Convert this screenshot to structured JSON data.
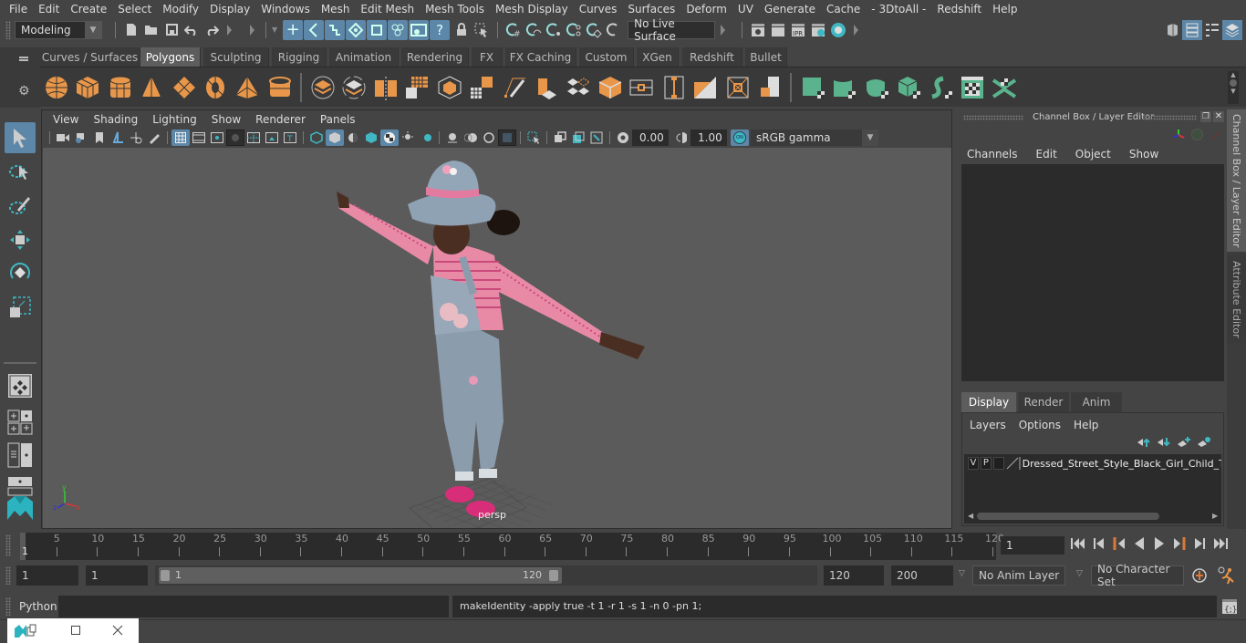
{
  "menubar": {
    "items": [
      "File",
      "Edit",
      "Create",
      "Select",
      "Modify",
      "Display",
      "Windows",
      "Mesh",
      "Edit Mesh",
      "Mesh Tools",
      "Mesh Display",
      "Curves",
      "Surfaces",
      "Deform",
      "UV",
      "Generate",
      "Cache",
      "- 3DtoAll -",
      "Redshift",
      "Help"
    ]
  },
  "statusline": {
    "workspace": "Modeling",
    "live_surface": "No Live Surface",
    "icons": [
      "new-scene-icon",
      "open-scene-icon",
      "save-scene-icon",
      "undo-icon",
      "redo-icon",
      "select-by-hierarchy-icon",
      "select-by-object-icon",
      "select-by-component-icon",
      "snap-grid-icon",
      "snap-curve-icon",
      "snap-point-icon",
      "snap-view-plane-icon",
      "snap-live-icon",
      "lock-icon",
      "select-highlight-icon",
      "render-view-icon",
      "render-current-icon",
      "ipr-render-icon",
      "render-settings-icon",
      "hypershade-icon"
    ],
    "ipr_label": "IPR"
  },
  "shelf": {
    "tabs": [
      "Curves / Surfaces",
      "Polygons",
      "Sculpting",
      "Rigging",
      "Animation",
      "Rendering",
      "FX",
      "FX Caching",
      "Custom",
      "XGen",
      "Redshift",
      "Bullet"
    ],
    "active_tab": "Polygons",
    "icons": [
      "poly-sphere",
      "poly-cube",
      "poly-cylinder",
      "poly-cone",
      "poly-plane",
      "poly-torus",
      "poly-pyramid",
      "poly-pipe",
      "combine",
      "separate",
      "extract",
      "smooth",
      "bevel-cube",
      "subdivide",
      "multi-cut",
      "extrude",
      "bridge",
      "append",
      "bevel",
      "edge-loop",
      "insert-edge",
      "target-weld",
      "merge",
      "uv-planar",
      "uv-cylindrical",
      "uv-spherical",
      "uv-auto",
      "uv-unfold",
      "uv-editor",
      "uv-layout"
    ]
  },
  "viewport": {
    "menu": [
      "View",
      "Shading",
      "Lighting",
      "Show",
      "Renderer",
      "Panels"
    ],
    "exposure": "0.00",
    "gamma": "1.00",
    "color_management_toggle": "ON",
    "color_space": "sRGB gamma",
    "camera_label": "persp",
    "axis": {
      "x": "x",
      "y": "y",
      "z": "z"
    }
  },
  "channel_box": {
    "title": "Channel Box / Layer Editor",
    "menu": [
      "Channels",
      "Edit",
      "Object",
      "Show"
    ]
  },
  "layer_editor": {
    "tabs": [
      "Display",
      "Render",
      "Anim"
    ],
    "active_tab": "Display",
    "menu": [
      "Layers",
      "Options",
      "Help"
    ],
    "layers": [
      {
        "visible": "V",
        "playback": "P",
        "name": "Dressed_Street_Style_Black_Girl_Child_T_Po"
      }
    ]
  },
  "side_tabs": [
    "Channel Box / Layer Editor",
    "Attribute Editor"
  ],
  "timeline": {
    "start_label": "1",
    "ticks": [
      5,
      10,
      15,
      20,
      25,
      30,
      35,
      40,
      45,
      50,
      55,
      60,
      65,
      70,
      75,
      80,
      85,
      90,
      95,
      100,
      105,
      110,
      115,
      120
    ],
    "range": [
      1,
      120
    ],
    "current_frame": "1"
  },
  "range_slider": {
    "start_time": "1",
    "playback_start": "1",
    "slider_min_label": "1",
    "slider_max_label": "120",
    "playback_end": "120",
    "end_time": "200",
    "anim_layer": "No Anim Layer",
    "character_set": "No Character Set"
  },
  "command_line": {
    "language": "Python",
    "input": "",
    "result": "makeIdentity -apply true -t 1 -r 1 -s 1 -n 0 -pn 1;"
  },
  "colors": {
    "accent": "#5d87a8",
    "shelf_orange": "#e8974a",
    "shelf_green": "#5ab38c",
    "teal": "#3fb8c4",
    "keyframe_orange": "#d97a3a"
  }
}
